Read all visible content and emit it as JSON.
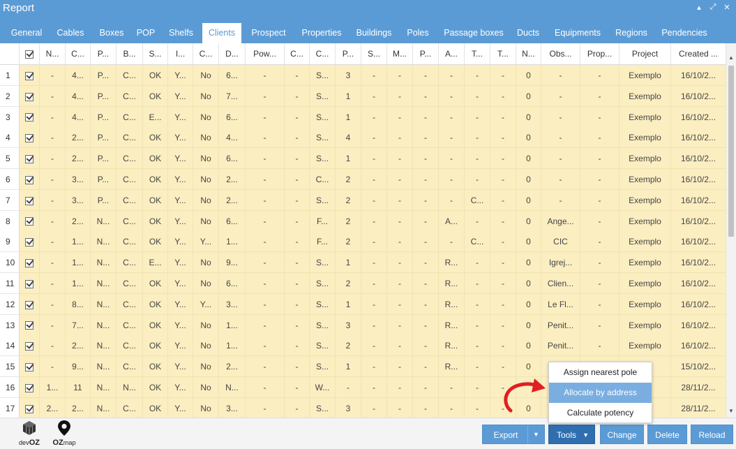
{
  "window": {
    "title": "Report"
  },
  "window_controls": [
    "▴",
    "⤢",
    "✕"
  ],
  "tabs": [
    {
      "label": "General",
      "active": false
    },
    {
      "label": "Cables",
      "active": false
    },
    {
      "label": "Boxes",
      "active": false
    },
    {
      "label": "POP",
      "active": false
    },
    {
      "label": "Shelfs",
      "active": false
    },
    {
      "label": "Clients",
      "active": true
    },
    {
      "label": "Prospect",
      "active": false
    },
    {
      "label": "Properties",
      "active": false
    },
    {
      "label": "Buildings",
      "active": false
    },
    {
      "label": "Poles",
      "active": false
    },
    {
      "label": "Passage boxes",
      "active": false
    },
    {
      "label": "Ducts",
      "active": false
    },
    {
      "label": "Equipments",
      "active": false
    },
    {
      "label": "Regions",
      "active": false
    },
    {
      "label": "Pendencies",
      "active": false
    }
  ],
  "columns": [
    "",
    "",
    "N...",
    "C...",
    "P...",
    "B...",
    "S...",
    "I...",
    "C...",
    "D...",
    "Pow...",
    "C...",
    "C...",
    "P...",
    "S...",
    "M...",
    "P...",
    "A...",
    "T...",
    "T...",
    "N...",
    "Obs...",
    "Prop...",
    "Project",
    "Created ..."
  ],
  "rows": [
    [
      "1",
      "-",
      "4...",
      "P...",
      "C...",
      "OK",
      "Y...",
      "No",
      "6...",
      "-",
      "-",
      "S...",
      "3",
      "-",
      "-",
      "-",
      "-",
      "-",
      "-",
      "0",
      "-",
      "-",
      "Exemplo",
      "16/10/2..."
    ],
    [
      "2",
      "-",
      "4...",
      "P...",
      "C...",
      "OK",
      "Y...",
      "No",
      "7...",
      "-",
      "-",
      "S...",
      "1",
      "-",
      "-",
      "-",
      "-",
      "-",
      "-",
      "0",
      "-",
      "-",
      "Exemplo",
      "16/10/2..."
    ],
    [
      "3",
      "-",
      "4...",
      "P...",
      "C...",
      "E...",
      "Y...",
      "No",
      "6...",
      "-",
      "-",
      "S...",
      "1",
      "-",
      "-",
      "-",
      "-",
      "-",
      "-",
      "0",
      "-",
      "-",
      "Exemplo",
      "16/10/2..."
    ],
    [
      "4",
      "-",
      "2...",
      "P...",
      "C...",
      "OK",
      "Y...",
      "No",
      "4...",
      "-",
      "-",
      "S...",
      "4",
      "-",
      "-",
      "-",
      "-",
      "-",
      "-",
      "0",
      "-",
      "-",
      "Exemplo",
      "16/10/2..."
    ],
    [
      "5",
      "-",
      "2...",
      "P...",
      "C...",
      "OK",
      "Y...",
      "No",
      "6...",
      "-",
      "-",
      "S...",
      "1",
      "-",
      "-",
      "-",
      "-",
      "-",
      "-",
      "0",
      "-",
      "-",
      "Exemplo",
      "16/10/2..."
    ],
    [
      "6",
      "-",
      "3...",
      "P...",
      "C...",
      "OK",
      "Y...",
      "No",
      "2...",
      "-",
      "-",
      "C...",
      "2",
      "-",
      "-",
      "-",
      "-",
      "-",
      "-",
      "0",
      "-",
      "-",
      "Exemplo",
      "16/10/2..."
    ],
    [
      "7",
      "-",
      "3...",
      "P...",
      "C...",
      "OK",
      "Y...",
      "No",
      "2...",
      "-",
      "-",
      "S...",
      "2",
      "-",
      "-",
      "-",
      "-",
      "C...",
      "-",
      "0",
      "-",
      "-",
      "Exemplo",
      "16/10/2..."
    ],
    [
      "8",
      "-",
      "2...",
      "N...",
      "C...",
      "OK",
      "Y...",
      "No",
      "6...",
      "-",
      "-",
      "F...",
      "2",
      "-",
      "-",
      "-",
      "A...",
      "-",
      "-",
      "0",
      "Ange...",
      "-",
      "Exemplo",
      "16/10/2..."
    ],
    [
      "9",
      "-",
      "1...",
      "N...",
      "C...",
      "OK",
      "Y...",
      "Y...",
      "1...",
      "-",
      "-",
      "F...",
      "2",
      "-",
      "-",
      "-",
      "-",
      "C...",
      "-",
      "0",
      "CIC",
      "-",
      "Exemplo",
      "16/10/2..."
    ],
    [
      "10",
      "-",
      "1...",
      "N...",
      "C...",
      "E...",
      "Y...",
      "No",
      "9...",
      "-",
      "-",
      "S...",
      "1",
      "-",
      "-",
      "-",
      "R...",
      "-",
      "-",
      "0",
      "Igrej...",
      "-",
      "Exemplo",
      "16/10/2..."
    ],
    [
      "11",
      "-",
      "1...",
      "N...",
      "C...",
      "OK",
      "Y...",
      "No",
      "6...",
      "-",
      "-",
      "S...",
      "2",
      "-",
      "-",
      "-",
      "R...",
      "-",
      "-",
      "0",
      "Clien...",
      "-",
      "Exemplo",
      "16/10/2..."
    ],
    [
      "12",
      "-",
      "8...",
      "N...",
      "C...",
      "OK",
      "Y...",
      "Y...",
      "3...",
      "-",
      "-",
      "S...",
      "1",
      "-",
      "-",
      "-",
      "R...",
      "-",
      "-",
      "0",
      "Le Fl...",
      "-",
      "Exemplo",
      "16/10/2..."
    ],
    [
      "13",
      "-",
      "7...",
      "N...",
      "C...",
      "OK",
      "Y...",
      "No",
      "1...",
      "-",
      "-",
      "S...",
      "3",
      "-",
      "-",
      "-",
      "R...",
      "-",
      "-",
      "0",
      "Penit...",
      "-",
      "Exemplo",
      "16/10/2..."
    ],
    [
      "14",
      "-",
      "2...",
      "N...",
      "C...",
      "OK",
      "Y...",
      "No",
      "1...",
      "-",
      "-",
      "S...",
      "2",
      "-",
      "-",
      "-",
      "R...",
      "-",
      "-",
      "0",
      "Penit...",
      "-",
      "Exemplo",
      "16/10/2..."
    ],
    [
      "15",
      "-",
      "9...",
      "N...",
      "C...",
      "OK",
      "Y...",
      "No",
      "2...",
      "-",
      "-",
      "S...",
      "1",
      "-",
      "-",
      "-",
      "R...",
      "-",
      "-",
      "0",
      "",
      "",
      "",
      "15/10/2..."
    ],
    [
      "16",
      "1...",
      "11",
      "N...",
      "N...",
      "OK",
      "Y...",
      "No",
      "N...",
      "-",
      "-",
      "W...",
      "-",
      "-",
      "-",
      "-",
      "-",
      "-",
      "-",
      "",
      "",
      "",
      "",
      "28/11/2..."
    ],
    [
      "17",
      "2...",
      "2...",
      "N...",
      "C...",
      "OK",
      "Y...",
      "No",
      "3...",
      "-",
      "-",
      "S...",
      "3",
      "-",
      "-",
      "-",
      "-",
      "-",
      "-",
      "0",
      "",
      "",
      "",
      "28/11/2..."
    ]
  ],
  "footer": {
    "logos": [
      {
        "name": "dev",
        "bold": "OZ",
        "icon": "cube-logo-icon"
      },
      {
        "name": "",
        "bold": "OZ",
        "suffix": "map",
        "icon": "map-pin-logo-icon"
      }
    ],
    "buttons": {
      "export": "Export",
      "tools": "Tools",
      "change": "Change",
      "delete": "Delete",
      "reload": "Reload"
    }
  },
  "tools_menu": {
    "items": [
      {
        "label": "Assign nearest pole",
        "highlighted": false
      },
      {
        "label": "Allocate by address",
        "highlighted": true
      },
      {
        "label": "Calculate potency",
        "highlighted": false
      }
    ]
  },
  "colors": {
    "accent": "#5b9bd5",
    "row_bg": "#fbeec1",
    "highlight": "#7aaee0",
    "annotation_arrow": "#e02020"
  }
}
